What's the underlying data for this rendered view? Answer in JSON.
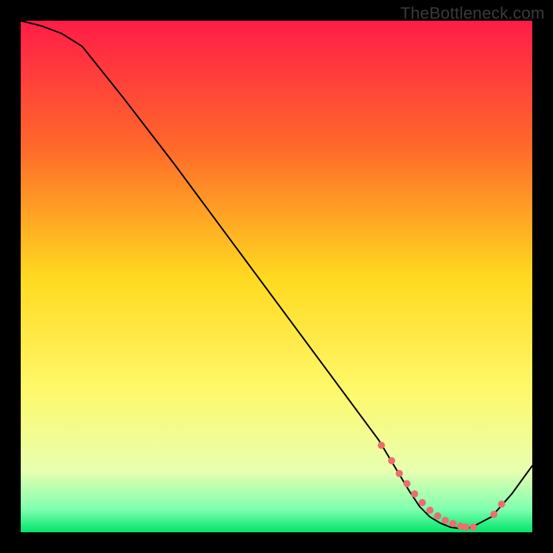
{
  "watermark": "TheBottleneck.com",
  "chart_data": {
    "type": "line",
    "title": "",
    "xlabel": "",
    "ylabel": "",
    "xlim": [
      0,
      100
    ],
    "ylim": [
      0,
      100
    ],
    "grid": false,
    "legend": false,
    "background_gradient": {
      "stops": [
        {
          "offset": 0.0,
          "color": "#ff1c48"
        },
        {
          "offset": 0.25,
          "color": "#ff6a2a"
        },
        {
          "offset": 0.5,
          "color": "#ffd91f"
        },
        {
          "offset": 0.72,
          "color": "#fff86a"
        },
        {
          "offset": 0.88,
          "color": "#e8ffb0"
        },
        {
          "offset": 0.955,
          "color": "#7fffb0"
        },
        {
          "offset": 1.0,
          "color": "#00e56a"
        }
      ]
    },
    "series": [
      {
        "name": "curve",
        "stroke": "#000000",
        "stroke_width": 2.2,
        "x": [
          0,
          4,
          8,
          12,
          20,
          30,
          40,
          50,
          60,
          70,
          73,
          76,
          78,
          80,
          82,
          84,
          86,
          88,
          92,
          96,
          100
        ],
        "y": [
          100,
          99,
          97.5,
          95,
          85,
          72,
          58.5,
          45,
          31.5,
          18,
          13,
          8,
          5,
          3,
          1.8,
          1.0,
          0.7,
          0.9,
          3.0,
          7.5,
          13
        ]
      }
    ],
    "markers": {
      "name": "highlight-points",
      "fill": "#ee6d6e",
      "radius": 5.2,
      "x": [
        70.5,
        72.5,
        74,
        75.5,
        77,
        78.5,
        80,
        81.5,
        83,
        84.5,
        86,
        87,
        88.5,
        92.5,
        94
      ],
      "y": [
        17.0,
        14.0,
        11.5,
        9.5,
        7.5,
        5.8,
        4.3,
        3.2,
        2.3,
        1.7,
        1.2,
        1.0,
        1.0,
        3.5,
        5.5
      ]
    }
  }
}
